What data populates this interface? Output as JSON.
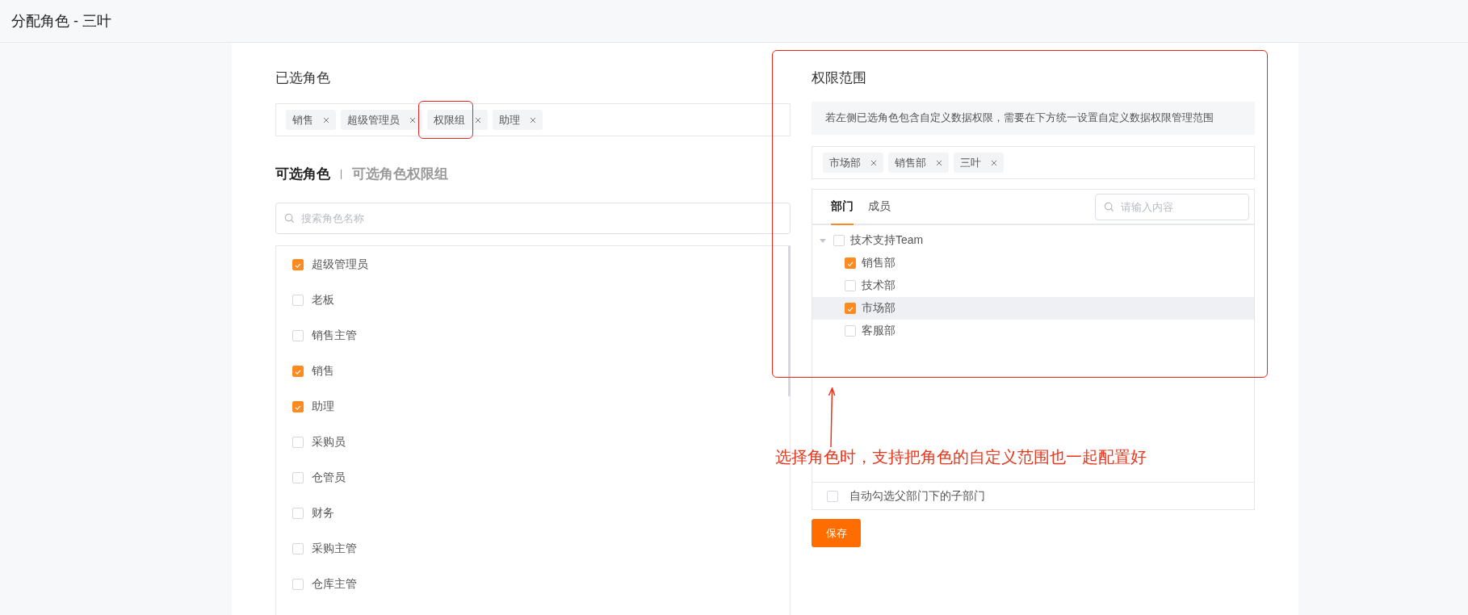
{
  "window": {
    "title": "分配角色 - 三叶"
  },
  "selected_roles": {
    "title": "已选角色",
    "tags": [
      {
        "label": "销售",
        "annotated": false
      },
      {
        "label": "超级管理员",
        "annotated": false
      },
      {
        "label": "权限组",
        "annotated": true
      },
      {
        "label": "助理",
        "annotated": false
      }
    ]
  },
  "role_tabs": [
    {
      "label": "可选角色",
      "selected": true
    },
    {
      "label": "可选角色权限组",
      "selected": false
    }
  ],
  "tab_separator": "|",
  "role_search": {
    "placeholder": "搜索角色名称"
  },
  "roles": [
    {
      "label": "超级管理员",
      "checked": true
    },
    {
      "label": "老板",
      "checked": false
    },
    {
      "label": "销售主管",
      "checked": false
    },
    {
      "label": "销售",
      "checked": true
    },
    {
      "label": "助理",
      "checked": true
    },
    {
      "label": "采购员",
      "checked": false
    },
    {
      "label": "仓管员",
      "checked": false
    },
    {
      "label": "财务",
      "checked": false
    },
    {
      "label": "采购主管",
      "checked": false
    },
    {
      "label": "仓库主管",
      "checked": false
    }
  ],
  "scope": {
    "title": "权限范围",
    "hint": "若左侧已选角色包含自定义数据权限，需要在下方统一设置自定义数据权限管理范围",
    "tags": [
      "市场部",
      "销售部",
      "三叶"
    ],
    "tabs": [
      {
        "label": "部门",
        "selected": true
      },
      {
        "label": "成员",
        "selected": false
      }
    ],
    "search": {
      "placeholder": "请输入内容"
    },
    "tree": [
      {
        "label": "技术支持Team",
        "checked": false,
        "expanded": true,
        "children": [
          {
            "label": "销售部",
            "checked": true,
            "highlighted": false
          },
          {
            "label": "技术部",
            "checked": false,
            "highlighted": false
          },
          {
            "label": "市场部",
            "checked": true,
            "highlighted": true
          },
          {
            "label": "客服部",
            "checked": false,
            "highlighted": false
          }
        ]
      }
    ],
    "auto_select": {
      "label": "自动勾选父部门下的子部门",
      "checked": false
    },
    "save_button": "保存"
  },
  "annotation": {
    "text": "选择角色时，支持把角色的自定义范围也一起配置好"
  }
}
